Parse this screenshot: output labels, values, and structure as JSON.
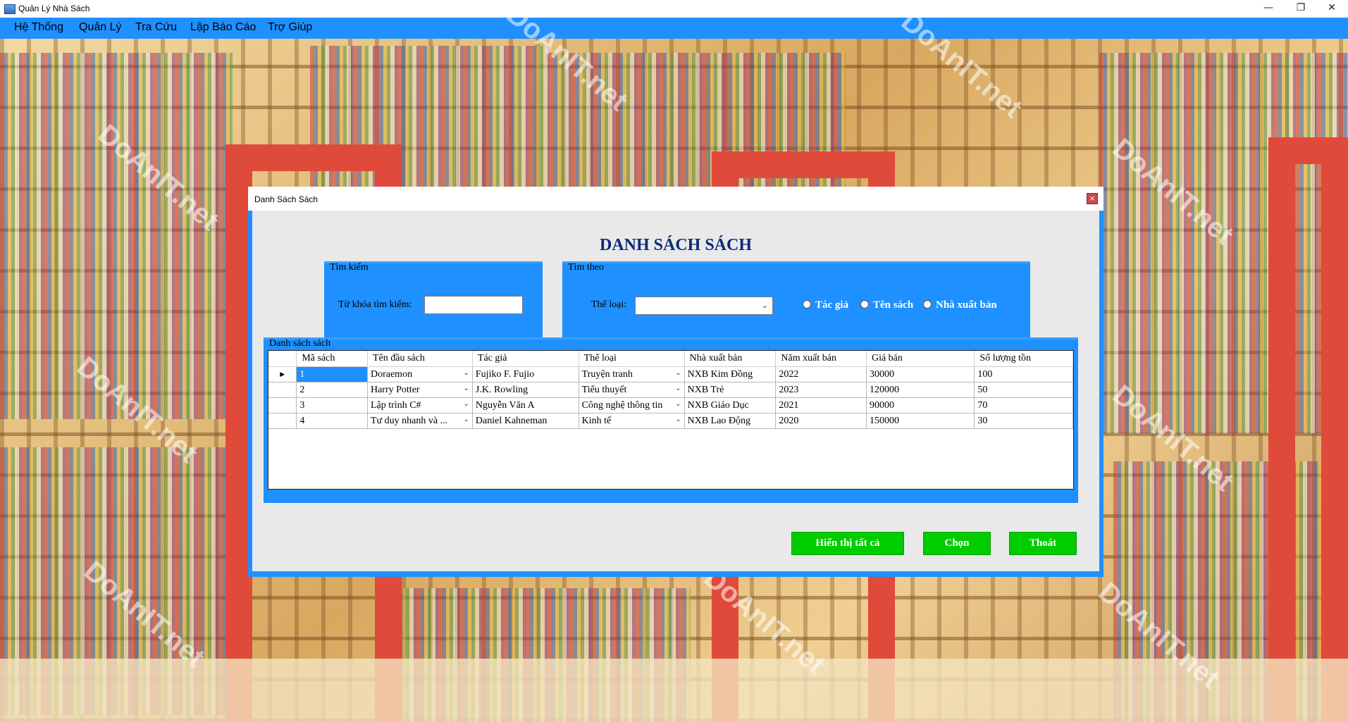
{
  "window": {
    "title": "Quản Lý Nhà Sách"
  },
  "menu": [
    "Hệ Thống",
    "Quản Lý",
    "Tra Cứu",
    "Lập Báo Cáo",
    "Trợ Giúp"
  ],
  "dialog": {
    "title": "Danh Sách Sách",
    "heading": "DANH SÁCH SÁCH",
    "search_group": {
      "legend": "Tìm kiếm",
      "keyword_label": "Từ khóa tìm kiếm:",
      "keyword_value": ""
    },
    "filter_group": {
      "legend": "Tìm theo",
      "category_label": "Thể loại:",
      "category_value": "",
      "radios": [
        "Tác giả",
        "Tên sách",
        "Nhà xuất bản"
      ]
    },
    "list_group": {
      "legend": "Danh sách sách"
    },
    "grid": {
      "columns": [
        "Mã sách",
        "Tên đầu sách",
        "Tác giả",
        "Thể loại",
        "Nhà xuất bản",
        "Năm xuất bản",
        "Giá bán",
        "Số lượng tồn"
      ],
      "rows": [
        [
          "1",
          "Doraemon",
          "Fujiko F. Fujio",
          "Truyện tranh",
          "NXB Kim Đồng",
          "2022",
          "30000",
          "100"
        ],
        [
          "2",
          "Harry Potter",
          "J.K. Rowling",
          "Tiểu thuyết",
          "NXB Trẻ",
          "2023",
          "120000",
          "50"
        ],
        [
          "3",
          "Lập trình C#",
          "Nguyễn Văn A",
          "Công nghệ thông tin",
          "NXB Giáo Dục",
          "2021",
          "90000",
          "70"
        ],
        [
          "4",
          "Tư duy nhanh và ...",
          "Daniel Kahneman",
          "Kinh tế",
          "NXB Lao Động",
          "2020",
          "150000",
          "30"
        ]
      ]
    },
    "buttons": {
      "show_all": "Hiển thị tất cả",
      "select": "Chọn",
      "exit": "Thoát"
    }
  },
  "watermark": "DoAnIT.net",
  "colors": {
    "accent": "#1e90ff",
    "button": "#00cc00",
    "heading": "#0b2a7a"
  }
}
